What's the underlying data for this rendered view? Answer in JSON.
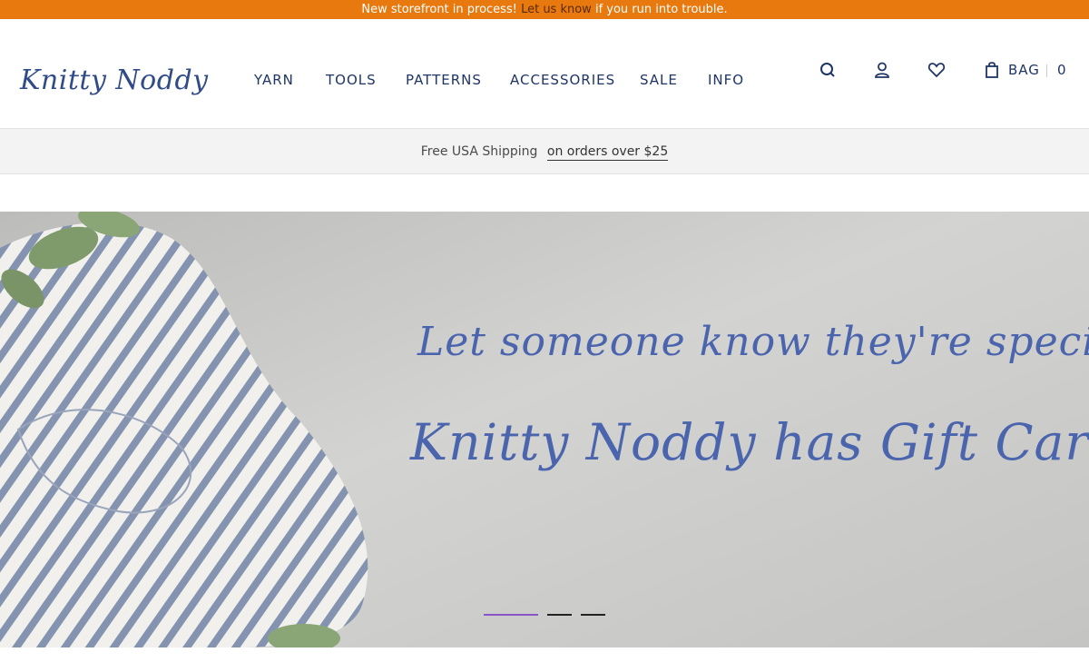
{
  "announcement": {
    "before": "New storefront in process! ",
    "link": "Let us know",
    "after": " if you run into trouble."
  },
  "header": {
    "logo": "Knitty Noddy",
    "nav": [
      {
        "label": "YARN"
      },
      {
        "label": "TOOLS"
      },
      {
        "label": "PATTERNS"
      },
      {
        "label": "ACCESSORIES"
      },
      {
        "label": "SALE"
      },
      {
        "label": "INFO"
      }
    ],
    "icons": [
      "search-icon",
      "account-icon",
      "wishlist-heart-icon",
      "bag-icon"
    ],
    "bag_label": "BAG",
    "bag_count": "0"
  },
  "shipping": {
    "text": "Free USA Shipping",
    "link": "on orders over $25"
  },
  "hero": {
    "line1": "Let someone know they're special!",
    "line2": "Knitty Noddy has Gift Cards!",
    "slides_total": 3,
    "active_slide": 1
  },
  "colors": {
    "announcement_bg": "#e8790f",
    "brand_blue": "#2f4c89",
    "hero_text": "#4a64ad",
    "active_dot": "#8a55c9"
  }
}
